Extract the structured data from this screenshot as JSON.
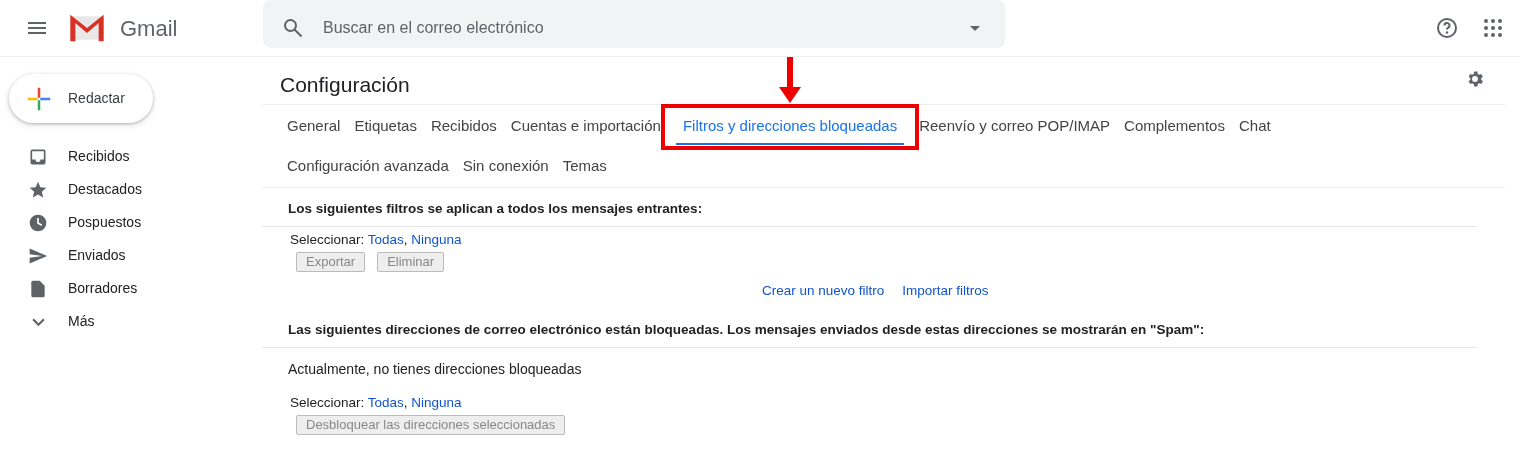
{
  "header": {
    "app_name": "Gmail",
    "search": {
      "placeholder": "Buscar en el correo electrónico"
    }
  },
  "compose": {
    "label": "Redactar"
  },
  "sidebar": {
    "items": [
      {
        "label": "Recibidos",
        "kind": "inbox"
      },
      {
        "label": "Destacados",
        "kind": "star"
      },
      {
        "label": "Pospuestos",
        "kind": "clock"
      },
      {
        "label": "Enviados",
        "kind": "send"
      },
      {
        "label": "Borradores",
        "kind": "draft"
      },
      {
        "label": "Más",
        "kind": "more"
      }
    ]
  },
  "settings": {
    "title": "Configuración",
    "tab_rows": [
      [
        {
          "label": "General",
          "selected": false,
          "highlighted": false
        },
        {
          "label": "Etiquetas",
          "selected": false,
          "highlighted": false
        },
        {
          "label": "Recibidos",
          "selected": false,
          "highlighted": false
        },
        {
          "label": "Cuentas e importación",
          "selected": false,
          "highlighted": false
        },
        {
          "label": "Filtros y direcciones bloqueadas",
          "selected": true,
          "highlighted": true
        },
        {
          "label": "Reenvío y correo POP/IMAP",
          "selected": false,
          "highlighted": false
        },
        {
          "label": "Complementos",
          "selected": false,
          "highlighted": false
        },
        {
          "label": "Chat",
          "selected": false,
          "highlighted": false
        }
      ],
      [
        {
          "label": "Configuración avanzada",
          "selected": false,
          "highlighted": false
        },
        {
          "label": "Sin conexión",
          "selected": false,
          "highlighted": false
        },
        {
          "label": "Temas",
          "selected": false,
          "highlighted": false
        }
      ]
    ],
    "filters": {
      "heading": "Los siguientes filtros se aplican a todos los mensajes entrantes:",
      "select": {
        "label": "Seleccionar:",
        "all": "Todas",
        "separator": ",",
        "none": "Ninguna"
      },
      "buttons": [
        {
          "label": "Exportar",
          "disabled": true
        },
        {
          "label": "Eliminar",
          "disabled": true
        }
      ],
      "links": [
        "Crear un nuevo filtro",
        "Importar filtros"
      ]
    },
    "blocked": {
      "heading": "Las siguientes direcciones de correo electrónico están bloqueadas. Los mensajes enviados desde estas direcciones se mostrarán en \"Spam\":",
      "empty_message": "Actualmente, no tienes direcciones bloqueadas",
      "select": {
        "label": "Seleccionar:",
        "all": "Todas",
        "separator": ",",
        "none": "Ninguna"
      },
      "buttons": [
        {
          "label": "Desbloquear las direcciones seleccionadas",
          "disabled": true
        }
      ]
    }
  }
}
